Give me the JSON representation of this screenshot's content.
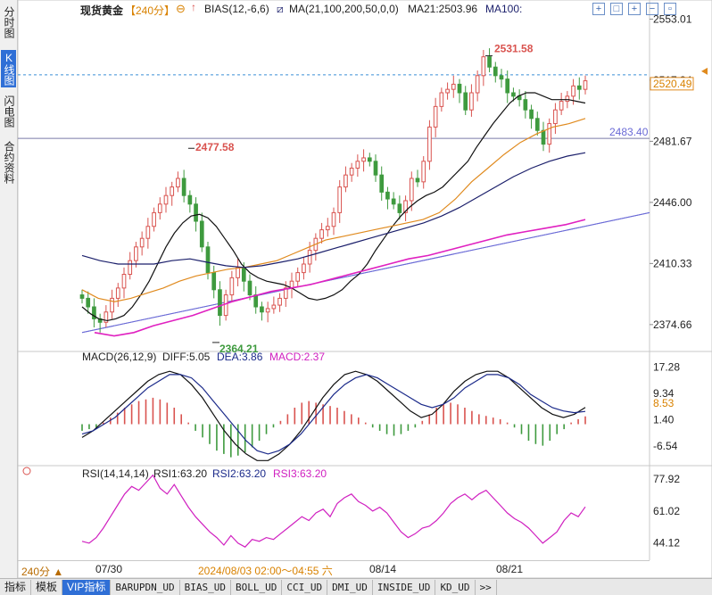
{
  "header": {
    "title": "现货黄金",
    "period": "【240分】",
    "bias_label": "BIAS(12,-6,6)",
    "ma_label": "MA(21,100,200,50,0,0)",
    "ma21_label": "MA21:2503.96",
    "ma100_label": "MA100:"
  },
  "sidebar": {
    "tabs": [
      {
        "label": "分时图",
        "active": false
      },
      {
        "label": "K线图",
        "active": true
      },
      {
        "label": "闪电图",
        "active": false
      },
      {
        "label": "合约资料",
        "active": false
      }
    ]
  },
  "price_axis": {
    "ticks": [
      "2553.01",
      "2517.34",
      "2481.67",
      "2446.00",
      "2410.33",
      "2374.66"
    ],
    "current_price": "2520.49",
    "ref_line_label": "2483.40"
  },
  "annotations": {
    "high": "2531.58",
    "mid_high": "2477.58",
    "low": "2364.21"
  },
  "macd": {
    "title": "MACD(26,12,9)",
    "diff_label": "DIFF:5.05",
    "dea_label": "DEA:3.86",
    "macd_label": "MACD:2.37",
    "ticks": [
      "17.28",
      "9.34",
      "1.40",
      "-6.54"
    ],
    "current": "8.53"
  },
  "rsi": {
    "title": "RSI(14,14,14)",
    "rsi1_label": "RSI1:63.20",
    "rsi2_label": "RSI2:63.20",
    "rsi3_label": "RSI3:63.20",
    "ticks": [
      "77.92",
      "61.02",
      "44.12"
    ]
  },
  "time_axis": {
    "period_button": "240分 ▲",
    "dates": [
      "07/30",
      "08/14",
      "08/21"
    ],
    "cursor_time": "2024/08/03 02:00～04:55 六"
  },
  "bottom_tabs": [
    {
      "label": "指标",
      "active": false,
      "cn": true
    },
    {
      "label": "模板",
      "active": false,
      "cn": true
    },
    {
      "label": "VIP指标",
      "active": true,
      "cn": true
    },
    {
      "label": "BARUPDN_UD",
      "active": false
    },
    {
      "label": "BIAS_UD",
      "active": false
    },
    {
      "label": "BOLL_UD",
      "active": false
    },
    {
      "label": "CCI_UD",
      "active": false
    },
    {
      "label": "DMI_UD",
      "active": false
    },
    {
      "label": "INSIDE_UD",
      "active": false
    },
    {
      "label": "KD_UD",
      "active": false
    },
    {
      "label": ">>",
      "active": false
    }
  ],
  "colors": {
    "up": "#d9534f",
    "down": "#3e9a3e",
    "ma21": "#111111",
    "ma50": "#e08a1e",
    "ma100": "#1b1f6b",
    "ma200": "#e020c0",
    "trendline": "#6a6ad6",
    "diff": "#111111",
    "dea": "#1b2a8a",
    "rsi": "#d020c0",
    "accent": "#2f6fd6"
  },
  "chart_data": [
    {
      "type": "candlestick",
      "title": "现货黄金",
      "period": "240分",
      "ylim": [
        2360,
        2560
      ],
      "ticks": [
        2553.01,
        2517.34,
        2481.67,
        2446.0,
        2410.33,
        2374.66
      ],
      "current_price": 2520.49,
      "reference_level": 2483.4,
      "annotated_points": {
        "high": 2531.58,
        "mid_high": 2477.58,
        "low": 2364.21
      },
      "closes": [
        2390,
        2385,
        2378,
        2376,
        2382,
        2390,
        2396,
        2404,
        2412,
        2420,
        2425,
        2432,
        2440,
        2445,
        2450,
        2455,
        2460,
        2450,
        2445,
        2435,
        2420,
        2405,
        2395,
        2380,
        2392,
        2402,
        2408,
        2400,
        2392,
        2385,
        2382,
        2384,
        2386,
        2390,
        2396,
        2400,
        2405,
        2410,
        2418,
        2425,
        2430,
        2432,
        2440,
        2455,
        2462,
        2466,
        2470,
        2472,
        2470,
        2462,
        2452,
        2448,
        2445,
        2440,
        2447,
        2460,
        2458,
        2470,
        2490,
        2502,
        2510,
        2512,
        2515,
        2510,
        2500,
        2510,
        2520,
        2531,
        2525,
        2520,
        2518,
        2510,
        2508,
        2506,
        2500,
        2495,
        2488,
        2480,
        2492,
        2500,
        2505,
        2508,
        2514,
        2512,
        2517
      ],
      "ma21": [
        2385,
        2381,
        2378,
        2377,
        2378,
        2380,
        2385,
        2392,
        2400,
        2410,
        2420,
        2428,
        2434,
        2438,
        2439,
        2437,
        2432,
        2425,
        2418,
        2410,
        2405,
        2402,
        2400,
        2399,
        2398,
        2396,
        2393,
        2390,
        2389,
        2390,
        2392,
        2395,
        2400,
        2404,
        2410,
        2418,
        2425,
        2432,
        2438,
        2443,
        2447,
        2450,
        2452,
        2455,
        2460,
        2465,
        2470,
        2478,
        2485,
        2492,
        2498,
        2504,
        2508,
        2510,
        2510,
        2508,
        2506,
        2506,
        2506,
        2505,
        2504
      ],
      "ma50": [
        2395,
        2390,
        2388,
        2390,
        2393,
        2396,
        2400,
        2403,
        2405,
        2407,
        2408,
        2410,
        2412,
        2416,
        2420,
        2424,
        2426,
        2428,
        2430,
        2432,
        2434,
        2436,
        2440,
        2448,
        2458,
        2466,
        2474,
        2481,
        2486,
        2490,
        2492,
        2495
      ],
      "ma100": [
        2415,
        2412,
        2410,
        2410,
        2410,
        2412,
        2413,
        2411,
        2409,
        2408,
        2409,
        2411,
        2413,
        2416,
        2419,
        2422,
        2425,
        2428,
        2431,
        2434,
        2438,
        2443,
        2449,
        2455,
        2461,
        2466,
        2470,
        2473,
        2475
      ],
      "ma200": [
        2370,
        2368,
        2370,
        2374,
        2377,
        2380,
        2384,
        2388,
        2391,
        2394,
        2396,
        2398,
        2401,
        2404,
        2407,
        2410,
        2413,
        2415,
        2418,
        2421,
        2424,
        2427,
        2429,
        2431,
        2433,
        2436
      ],
      "trendline": [
        [
          2370,
          2412
        ],
        [
          2437,
          2440
        ]
      ]
    },
    {
      "type": "bar",
      "title": "MACD(26,12,9)",
      "ylim": [
        -12,
        22
      ],
      "ticks": [
        17.28,
        9.34,
        1.4,
        -6.54
      ],
      "values": [
        -2.0,
        -1.5,
        -1.0,
        0.5,
        2.0,
        3.5,
        5.0,
        6.0,
        7.0,
        7.5,
        8.0,
        7.5,
        6.5,
        5.0,
        3.0,
        0.5,
        -2.0,
        -4.0,
        -6.0,
        -8.0,
        -9.0,
        -10.0,
        -9.5,
        -8.5,
        -7.0,
        -5.0,
        -3.0,
        -1.0,
        1.0,
        3.0,
        5.0,
        6.5,
        7.0,
        6.5,
        6.0,
        5.5,
        5.0,
        4.0,
        3.0,
        2.0,
        0.5,
        -1.0,
        -2.0,
        -3.0,
        -3.5,
        -3.0,
        -2.0,
        -1.0,
        1.0,
        3.0,
        5.0,
        6.0,
        6.5,
        6.0,
        5.0,
        4.0,
        3.0,
        2.5,
        2.0,
        1.5,
        0.5,
        -1.0,
        -3.0,
        -5.0,
        -6.0,
        -6.5,
        -5.0,
        -3.0,
        -1.5,
        0.5,
        1.5,
        2.37
      ],
      "diff": [
        -4,
        -2,
        1,
        4,
        7,
        10,
        13,
        15,
        16,
        15,
        12,
        8,
        3,
        -2,
        -6,
        -9,
        -11,
        -11,
        -9,
        -6,
        -2,
        3,
        8,
        12,
        15,
        16,
        15,
        13,
        10,
        7,
        4,
        2,
        3,
        6,
        10,
        13,
        15,
        16,
        16,
        14,
        11,
        8,
        5,
        3,
        2,
        3,
        5.05
      ],
      "dea": [
        -3,
        -2,
        0,
        2,
        5,
        8,
        11,
        13,
        15,
        15,
        14,
        11,
        7,
        3,
        -1,
        -5,
        -8,
        -9,
        -8,
        -6,
        -3,
        1,
        5,
        9,
        12,
        14,
        15,
        14,
        12,
        10,
        8,
        6,
        5,
        6,
        8,
        11,
        13,
        15,
        15,
        14,
        12,
        9,
        7,
        5,
        4,
        3.5,
        3.86
      ]
    },
    {
      "type": "line",
      "title": "RSI(14,14,14)",
      "ylim": [
        35,
        85
      ],
      "ticks": [
        77.92,
        61.02,
        44.12
      ],
      "values": [
        45,
        44,
        47,
        52,
        58,
        64,
        70,
        74,
        72,
        76,
        80,
        73,
        70,
        75,
        69,
        63,
        58,
        54,
        50,
        47,
        43,
        48,
        44,
        42,
        46,
        45,
        47,
        46,
        49,
        52,
        55,
        58,
        56,
        60,
        62,
        58,
        65,
        68,
        70,
        66,
        64,
        61,
        63,
        60,
        55,
        50,
        47,
        49,
        52,
        53,
        56,
        60,
        65,
        68,
        70,
        67,
        70,
        72,
        68,
        64,
        60,
        57,
        55,
        52,
        48,
        44,
        47,
        50,
        56,
        60,
        58,
        63.2
      ]
    }
  ]
}
